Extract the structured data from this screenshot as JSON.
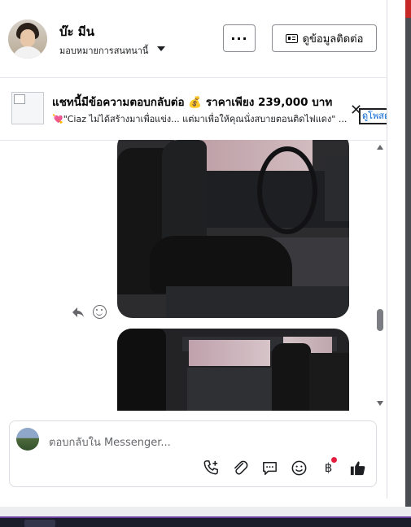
{
  "header": {
    "name": "บ๊ะ มีน",
    "subtitle": "มอบหมายการสนทนานี้",
    "more_label": "···",
    "contact_label": "ดูข้อมูลติดต่อ"
  },
  "listing": {
    "title": "แชทนี้มีข้อความตอบกลับต่อ 💰 ราคาเพียง 239,000 บาท",
    "message": "💘\"Ciaz ไม่ได้สร้างมาเพื่อแข่ง... แต่มาเพื่อให้คุณนั่งสบายตอนติดไฟแดง\" ...",
    "close_label": "✕",
    "view_label": "ดูโพสต์"
  },
  "chat": {
    "photo1_icon": "car-interior-front-photo",
    "photo2_icon": "car-interior-rear-photo"
  },
  "composer": {
    "placeholder": "ตอบกลับใน Messenger...",
    "icons": [
      "call-plus-icon",
      "attach-icon",
      "saved-reply-icon",
      "emoji-icon",
      "baht-icon",
      "like-icon"
    ],
    "baht_label": "฿"
  },
  "colors": {
    "accent": "#0064d1",
    "like": "#1c1e21",
    "notification_dot": "#e41e3f"
  }
}
